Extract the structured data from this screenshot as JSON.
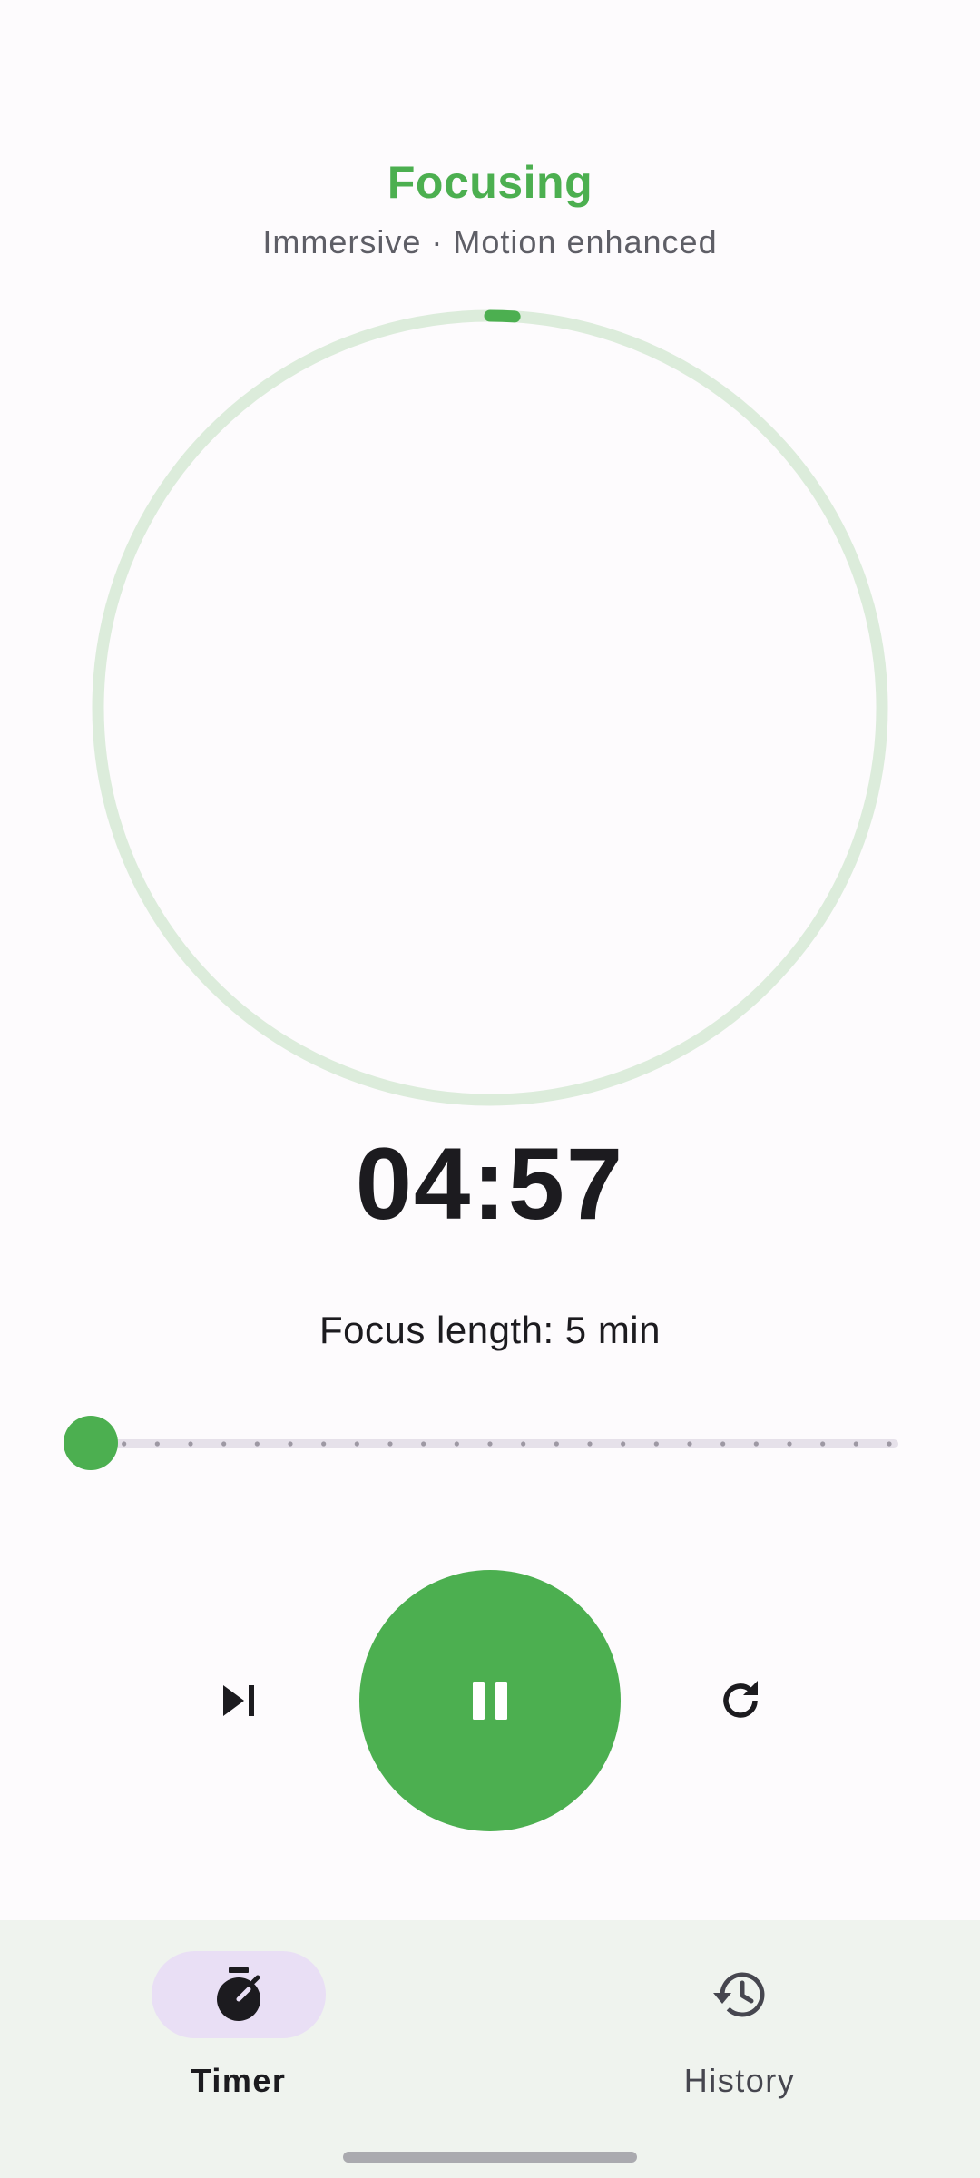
{
  "header": {
    "title": "Focusing",
    "subtitle": "Immersive · Motion enhanced"
  },
  "timer": {
    "display": "04:57",
    "progress_fraction": 0.01
  },
  "focus_length": {
    "label": "Focus length: 5 min",
    "slider_value_fraction": 0.0,
    "step_count": 24
  },
  "controls": {
    "skip_icon": "skip-next-icon",
    "main_icon": "pause-icon",
    "reset_icon": "refresh-icon"
  },
  "bottom_nav": {
    "items": [
      {
        "label": "Timer",
        "icon": "timer-icon",
        "selected": true
      },
      {
        "label": "History",
        "icon": "history-icon",
        "selected": false
      }
    ]
  },
  "colors": {
    "accent": "#4caf50",
    "ring_track": "#dcecdb",
    "background": "#fdfbfd",
    "nav_background": "#eff3ee",
    "nav_selected_pill": "#e9dff5"
  }
}
